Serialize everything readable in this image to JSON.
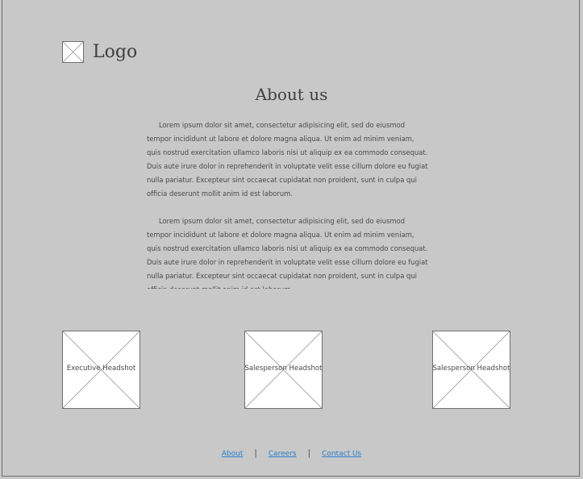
{
  "header": {
    "logo_text": "Logo",
    "logo_icon": "image-placeholder-icon"
  },
  "page_title": "About us",
  "paragraphs": [
    "Lorem ipsum dolor sit amet, consectetur adipisicing elit, sed do eiusmod tempor incididunt ut labore et dolore magna aliqua. Ut enim ad minim veniam, quis nostrud exercitation ullamco laboris nisi ut aliquip ex ea commodo consequat. Duis aute irure dolor in reprehenderit in voluptate velit esse cillum dolore eu fugiat nulla pariatur. Excepteur sint occaecat cupidatat non proident, sunt in culpa qui officia deserunt mollit anim id est laborum.",
    "Lorem ipsum dolor sit amet, consectetur adipisicing elit, sed do eiusmod tempor incididunt ut labore et dolore magna aliqua. Ut enim ad minim veniam, quis nostrud exercitation ullamco laboris nisi ut aliquip ex ea commodo consequat. Duis aute irure dolor in reprehenderit in voluptate velit esse cillum dolore eu fugiat nulla pariatur. Excepteur sint occaecat cupidatat non proident, sunt in culpa qui officia deserunt mollit anim id est laborum."
  ],
  "headshots": [
    {
      "label": "Executive Headshot"
    },
    {
      "label": "Salesperson Headshot"
    },
    {
      "label": "Salesperson Headshot"
    }
  ],
  "footer": {
    "links": [
      "About",
      "Careers",
      "Contact Us"
    ],
    "separator": "|",
    "link_color": "#2a7fd0"
  }
}
